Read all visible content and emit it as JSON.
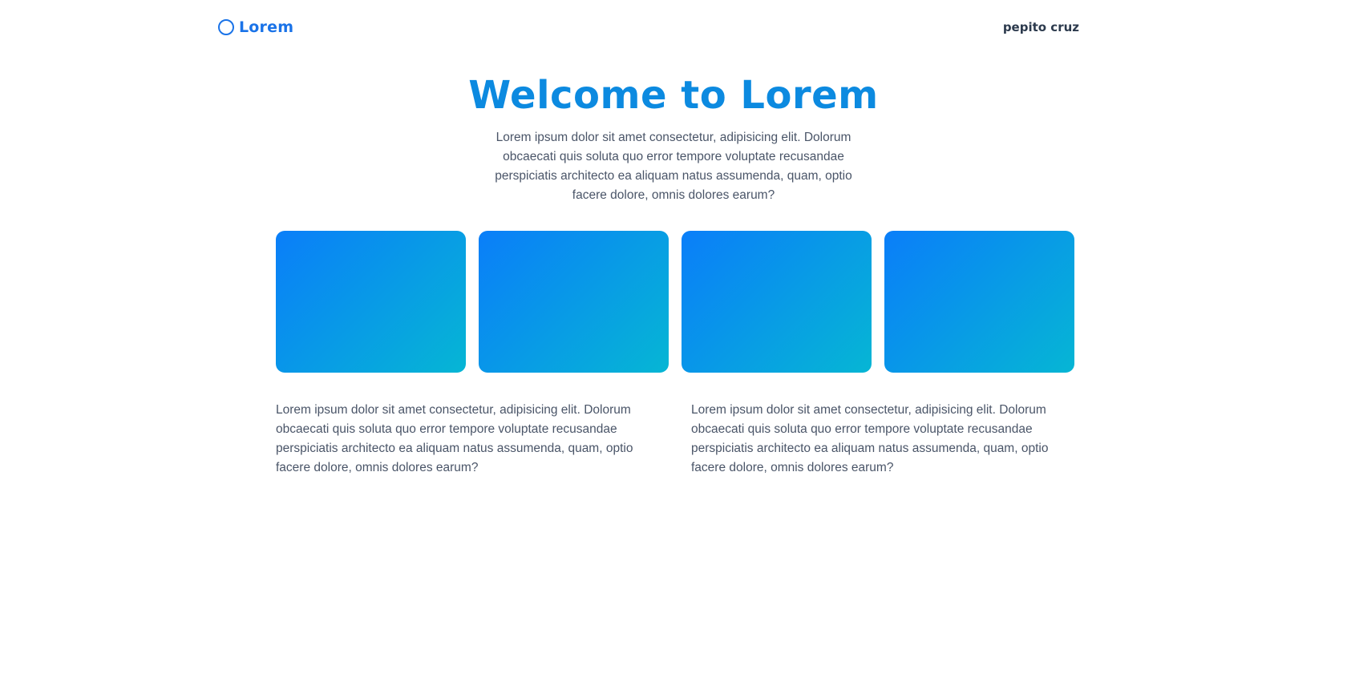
{
  "header": {
    "brand_name": "Lorem",
    "brand_icon": "circle-logo-icon",
    "user_name": "pepito cruz"
  },
  "hero": {
    "title": "Welcome to Lorem",
    "description": "Lorem ipsum dolor sit amet consectetur, adipisicing elit. Dolorum obcaecati quis soluta quo error tempore voluptate recusandae perspiciatis architecto ea aliquam natus assumenda, quam, optio facere dolore, omnis dolores earum?"
  },
  "cards": [
    {
      "gradient_start": "#0a7ef9",
      "gradient_end": "#06b6d4"
    },
    {
      "gradient_start": "#0a7ef9",
      "gradient_end": "#06b6d4"
    },
    {
      "gradient_start": "#0a7ef9",
      "gradient_end": "#06b6d4"
    },
    {
      "gradient_start": "#0a7ef9",
      "gradient_end": "#06b6d4"
    }
  ],
  "columns": [
    {
      "text": "Lorem ipsum dolor sit amet consectetur, adipisicing elit. Dolorum obcaecati quis soluta quo error tempore voluptate recusandae perspiciatis architecto ea aliquam natus assumenda, quam, optio facere dolore, omnis dolores earum?"
    },
    {
      "text": "Lorem ipsum dolor sit amet consectetur, adipisicing elit. Dolorum obcaecati quis soluta quo error tempore voluptate recusandae perspiciatis architecto ea aliquam natus assumenda, quam, optio facere dolore, omnis dolores earum?"
    }
  ],
  "colors": {
    "brand": "#1a73e8",
    "title": "#0c8ae0",
    "text": "#4a5568",
    "user": "#2c3a4d"
  }
}
